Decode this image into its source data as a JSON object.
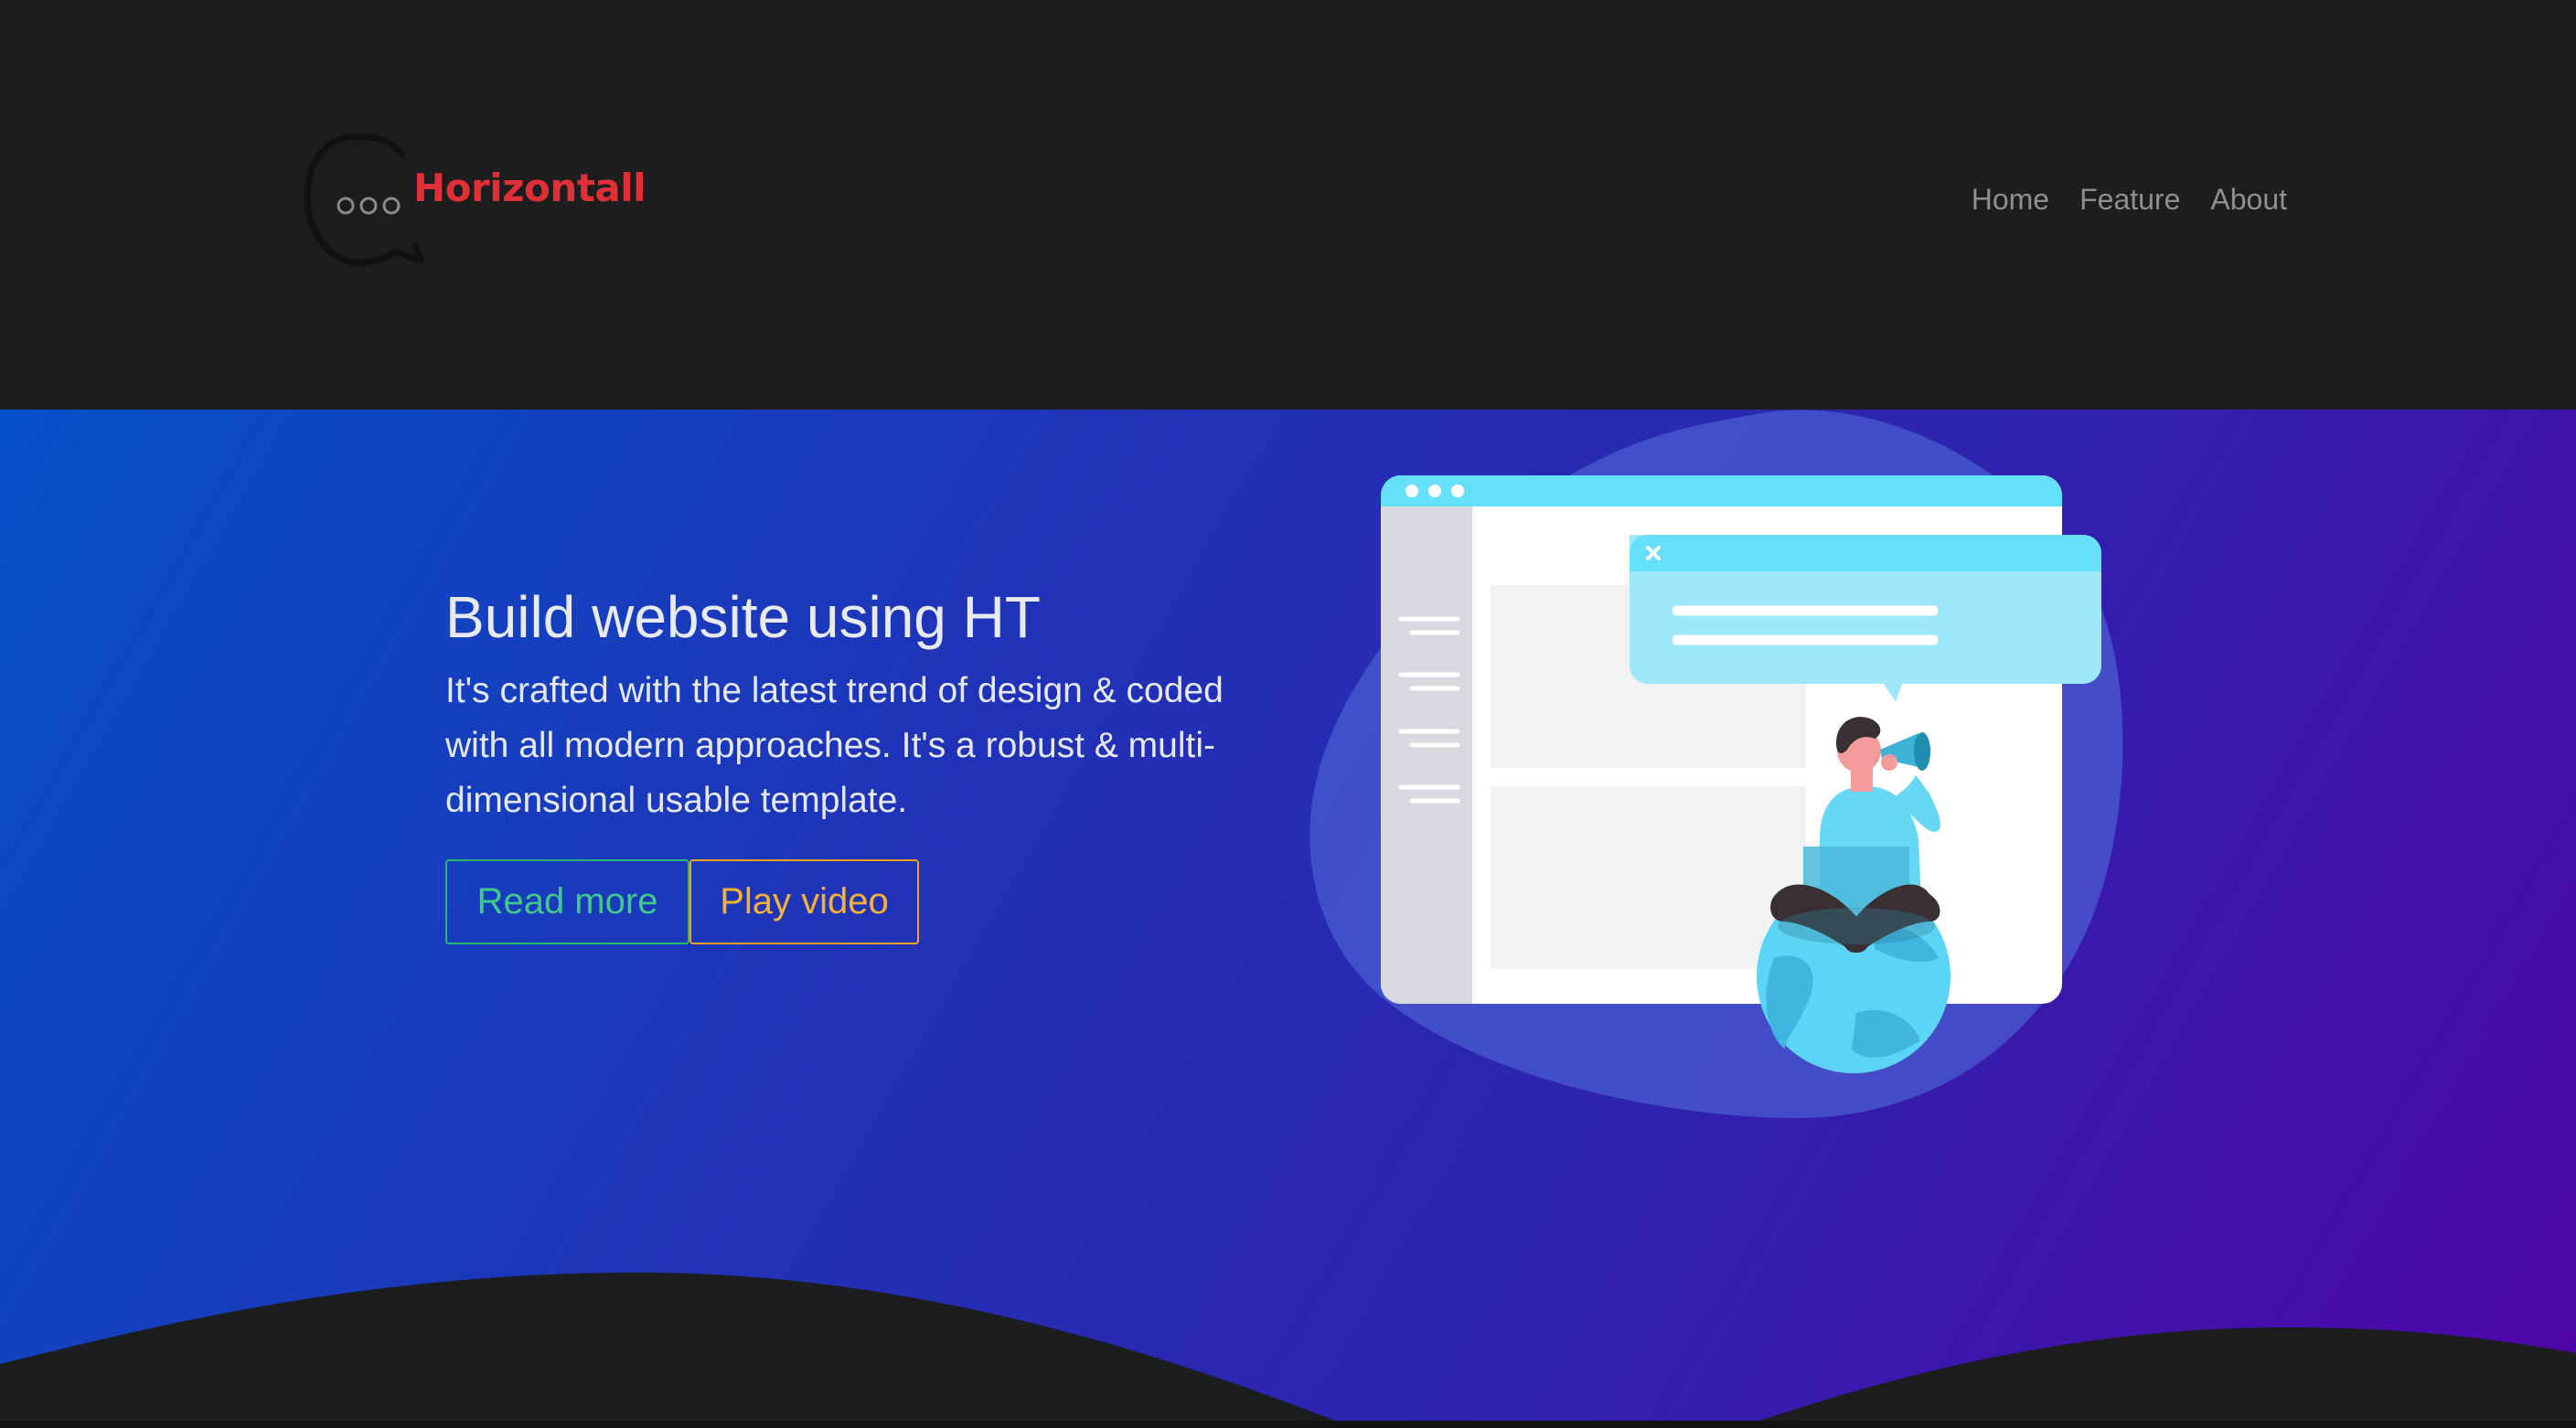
{
  "brand": {
    "name": "Horizontall",
    "name_color": "#e02f36",
    "icon": "chat-bubble-logo-icon"
  },
  "nav": {
    "home": "Home",
    "feature": "Feature",
    "about": "About"
  },
  "hero": {
    "title": "Build website using HT",
    "description": "It's crafted with the latest trend of design & coded with all modern approaches. It's a robust & multi-dimensional usable template.",
    "read_more": "Read more",
    "play_video": "Play video",
    "illustration": "person-with-megaphone-on-globe-illustration"
  },
  "colors": {
    "header_bg": "#1b1d1f",
    "hero_gradient_start": "#0550c8",
    "hero_gradient_end": "#5005a8",
    "read_more_border": "#2bb673",
    "play_video_border": "#f0a31a",
    "accent_cyan": "#66e0fa"
  }
}
